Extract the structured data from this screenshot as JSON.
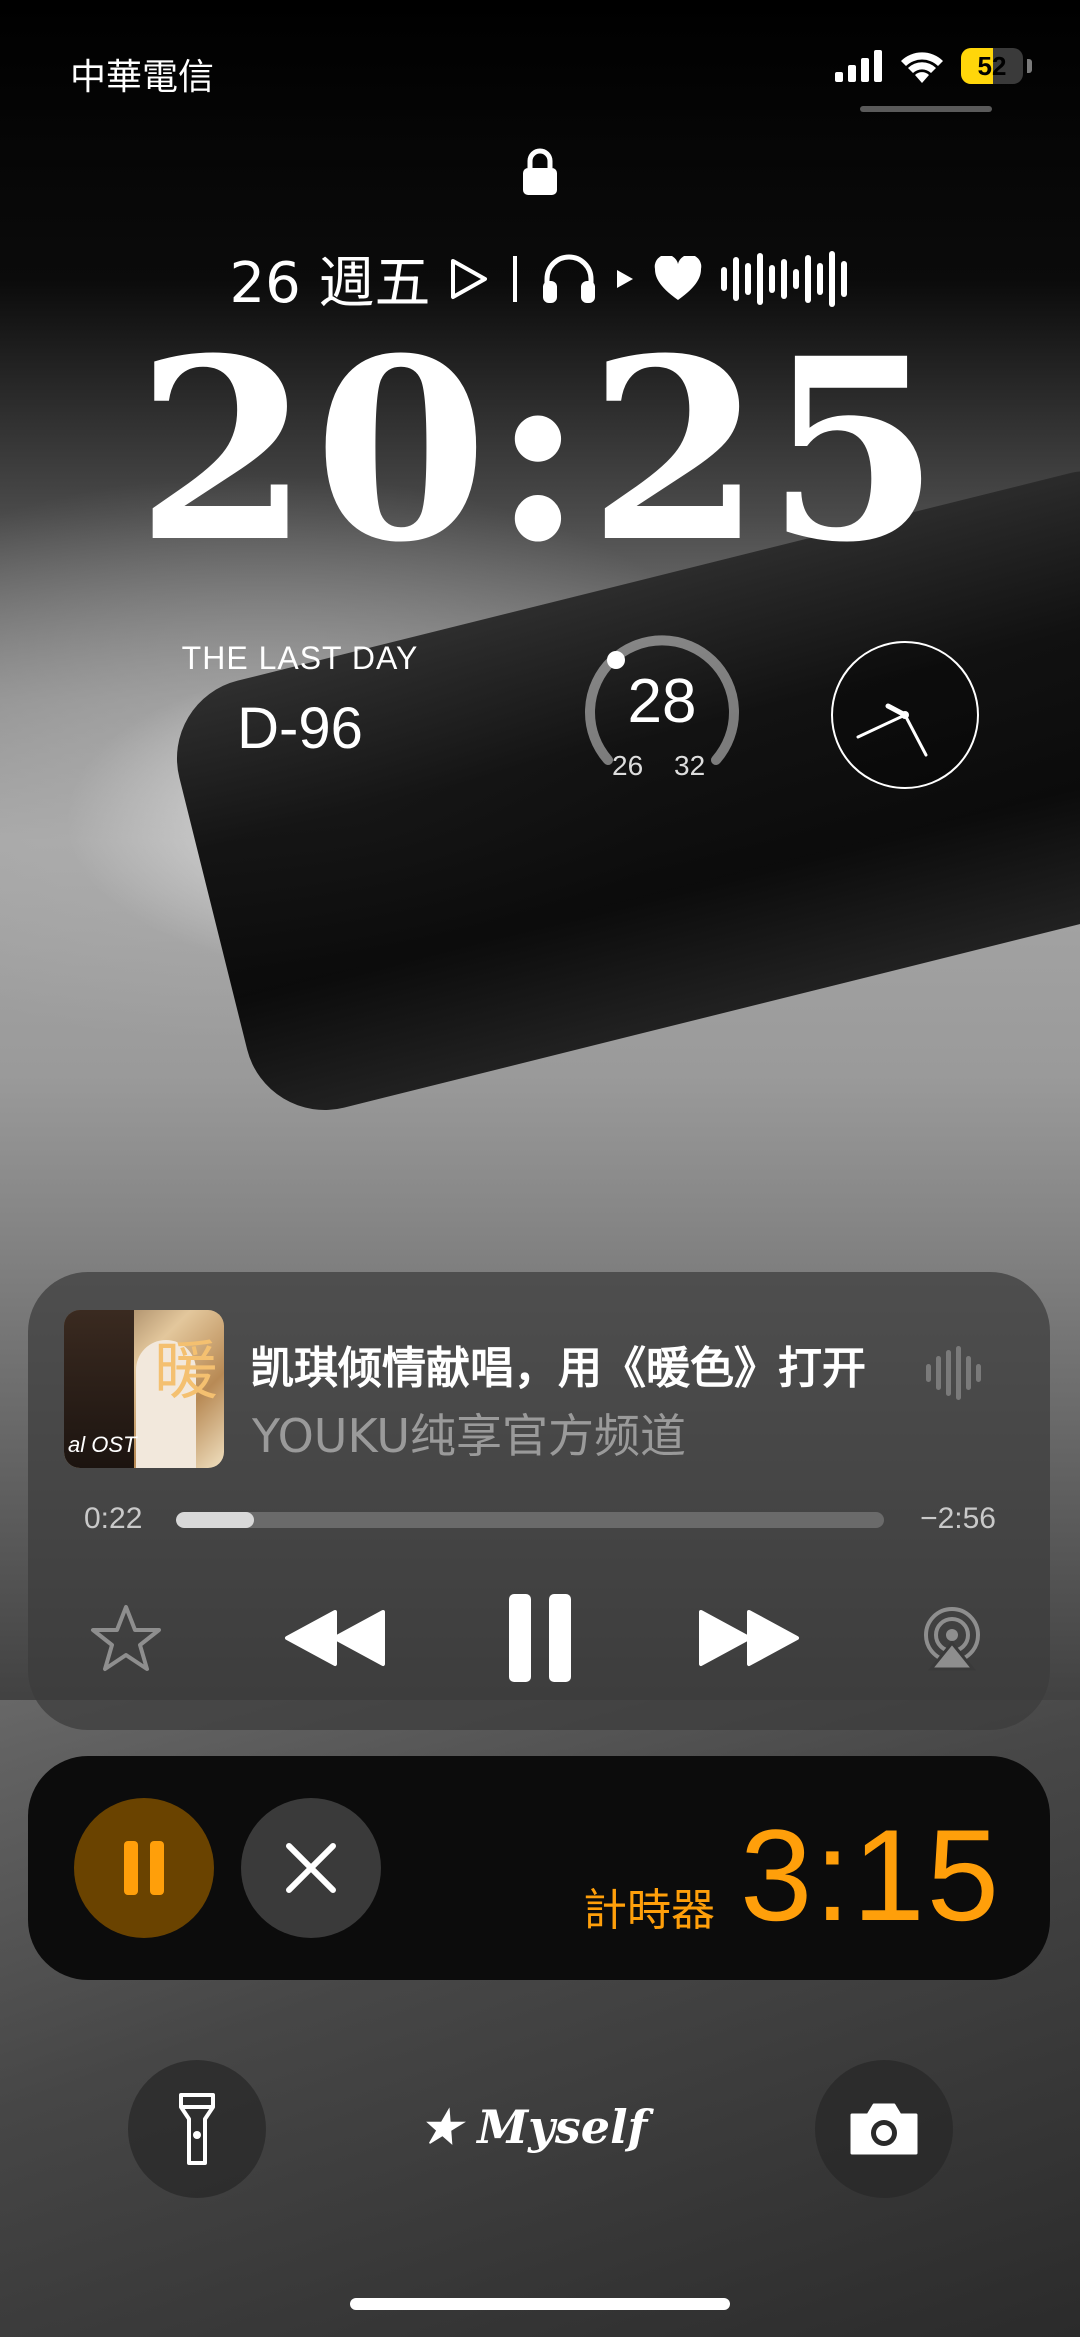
{
  "status_bar": {
    "carrier": "中華電信",
    "battery_level": "52",
    "battery_percent": 52
  },
  "lock_screen": {
    "date": "26 週五",
    "time": "20:25",
    "countdown": {
      "label": "THE LAST DAY",
      "value": "D-96"
    },
    "temperature": {
      "current": "28",
      "low": "26",
      "high": "32"
    },
    "signature": "Myself"
  },
  "media": {
    "title": "凯琪倾情献唱，用《暖色》打开",
    "artist": "YOUKU纯享官方频道",
    "album_art_char": "暖",
    "album_art_text": "al OST",
    "elapsed": "0:22",
    "remaining": "−2:56",
    "progress": 0.11
  },
  "timer": {
    "label": "計時器",
    "value": "3:15",
    "color": "#ff9f0a"
  },
  "icons": {
    "lock": "lock-icon",
    "play_outline": "play-outline-icon",
    "headphones": "headphones-icon",
    "heart": "heart-icon",
    "waveform": "waveform-icon",
    "star": "star-icon",
    "rewind": "rewind-icon",
    "pause": "pause-icon",
    "forward": "fast-forward-icon",
    "airplay": "airplay-icon",
    "close": "close-icon",
    "flashlight": "flashlight-icon",
    "camera": "camera-icon"
  }
}
